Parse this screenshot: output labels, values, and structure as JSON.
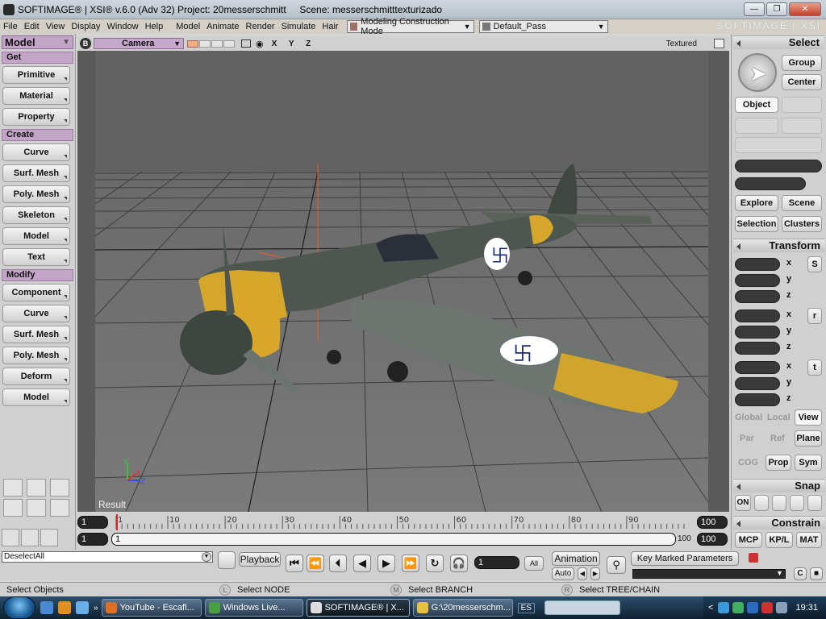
{
  "window": {
    "title": "SOFTIMAGE® | XSI® v.6.0 (Adv 32) Project: 20messerschmitt     Scene: messerschmitttexturizado",
    "minimize_glyph": "—",
    "maximize_glyph": "❐",
    "close_glyph": "✕"
  },
  "menubar": {
    "items": [
      "File",
      "Edit",
      "View",
      "Display",
      "Window",
      "Help",
      "Model",
      "Animate",
      "Render",
      "Simulate",
      "Hair"
    ],
    "mode_combo": "Modeling Construction Mode",
    "pass_combo": "Default_Pass",
    "brand": "SOFTIMAGE | XSI"
  },
  "left_toolbar": {
    "module": "Model",
    "sections": [
      {
        "header": "Get",
        "buttons": [
          "Primitive",
          "Material",
          "Property"
        ]
      },
      {
        "header": "Create",
        "buttons": [
          "Curve",
          "Surf. Mesh",
          "Poly. Mesh",
          "Skeleton",
          "Model",
          "Text"
        ]
      },
      {
        "header": "Modify",
        "buttons": [
          "Component",
          "Curve",
          "Surf. Mesh",
          "Poly. Mesh",
          "Deform",
          "Model"
        ]
      }
    ]
  },
  "viewport": {
    "letter": "B",
    "camera": "Camera",
    "axes": "X Y Z",
    "display_mode": "Textured",
    "label": "Result",
    "gizmo": {
      "y": "Y",
      "x": "X",
      "z": "Z"
    }
  },
  "right_toolbar": {
    "title": "Select",
    "group": "Group",
    "center": "Center",
    "object": "Object",
    "explore": "Explore",
    "scene": "Scene",
    "selection": "Selection",
    "clusters": "Clusters",
    "transform": "Transform",
    "s": "S",
    "r": "r",
    "t": "t",
    "x": "x",
    "y": "y",
    "z": "z",
    "global": "Global",
    "local": "Local",
    "view": "View",
    "par": "Par",
    "ref": "Ref",
    "plane": "Plane",
    "cog": "COG",
    "prop": "Prop",
    "sym": "Sym",
    "snap": "Snap",
    "on": "ON",
    "constrain": "Constrain",
    "mcp": "MCP",
    "kpl": "KP/L",
    "mat": "MAT"
  },
  "timeline": {
    "start": "1",
    "end": "100",
    "current": "1",
    "range_end": "100",
    "end2": "100",
    "marks": [
      "1",
      "10",
      "20",
      "30",
      "40",
      "50",
      "60",
      "70",
      "80",
      "90"
    ],
    "range_start": "1"
  },
  "cmdbar": {
    "command": "DeselectAll",
    "playback": "Playback",
    "frame": "1",
    "all": "All",
    "animation": "Animation",
    "auto": "Auto",
    "key_marked": "Key Marked Parameters",
    "prev": "◀",
    "next": "▶",
    "drop": "▼"
  },
  "statusbar": {
    "left_hint": "Select Objects",
    "l_mouse": "L",
    "l_text": "Select NODE",
    "m_mouse": "M",
    "m_text": "Select BRANCH",
    "r_mouse": "R",
    "r_text": "Select TREE/CHAIN"
  },
  "taskbar": {
    "tasks": [
      "YouTube - Escafl...",
      "Windows Live...",
      "SOFTIMAGE® | X...",
      "G:\\20messerschm..."
    ],
    "lang": "ES",
    "more": "»",
    "tray_arrow": "<",
    "time": "19:31"
  }
}
